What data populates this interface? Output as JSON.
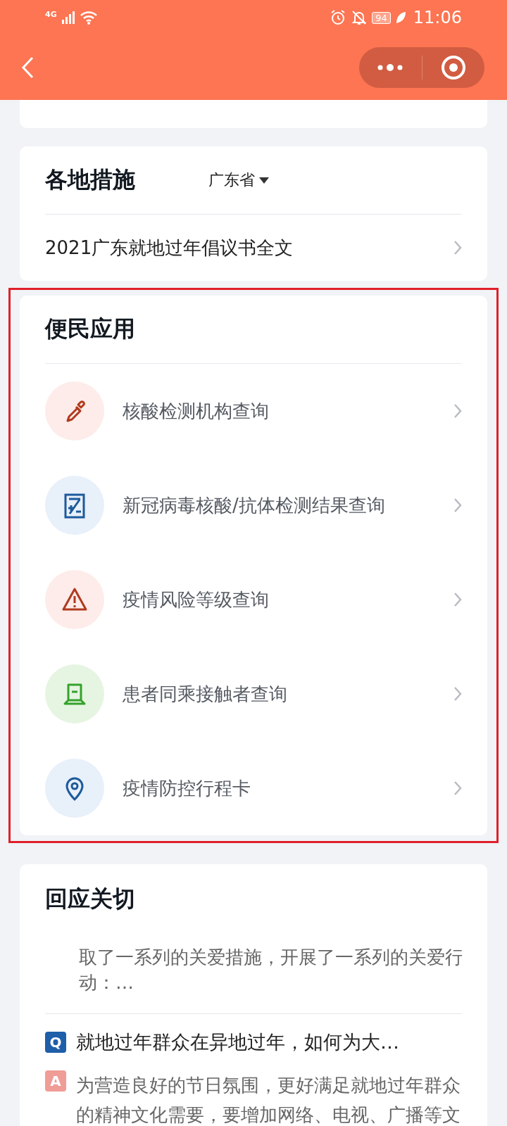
{
  "status_bar": {
    "network": "4G",
    "battery": "94",
    "time": "11:06"
  },
  "measures": {
    "title": "各地措施",
    "region": "广东省",
    "items": [
      {
        "label": "2021广东就地过年倡议书全文"
      }
    ]
  },
  "apps": {
    "title": "便民应用",
    "items": [
      {
        "label": "核酸检测机构查询",
        "kind": "dropper"
      },
      {
        "label": "新冠病毒核酸/抗体检测结果查询",
        "kind": "report"
      },
      {
        "label": "疫情风险等级查询",
        "kind": "warning"
      },
      {
        "label": "患者同乘接触者查询",
        "kind": "train"
      },
      {
        "label": "疫情防控行程卡",
        "kind": "location"
      }
    ]
  },
  "responses": {
    "title": "回应关切",
    "items": [
      {
        "answer": "取了一系列的关爱措施，开展了一系列的关爱行动：…"
      },
      {
        "question_badge": "Q",
        "question": "就地过年群众在异地过年，如何为大…",
        "answer_badge": "A",
        "answer": "为营造良好的节日氛围，更好满足就地过年群众的精神文化需要，要增加网络、电视、广播等文"
      }
    ]
  }
}
